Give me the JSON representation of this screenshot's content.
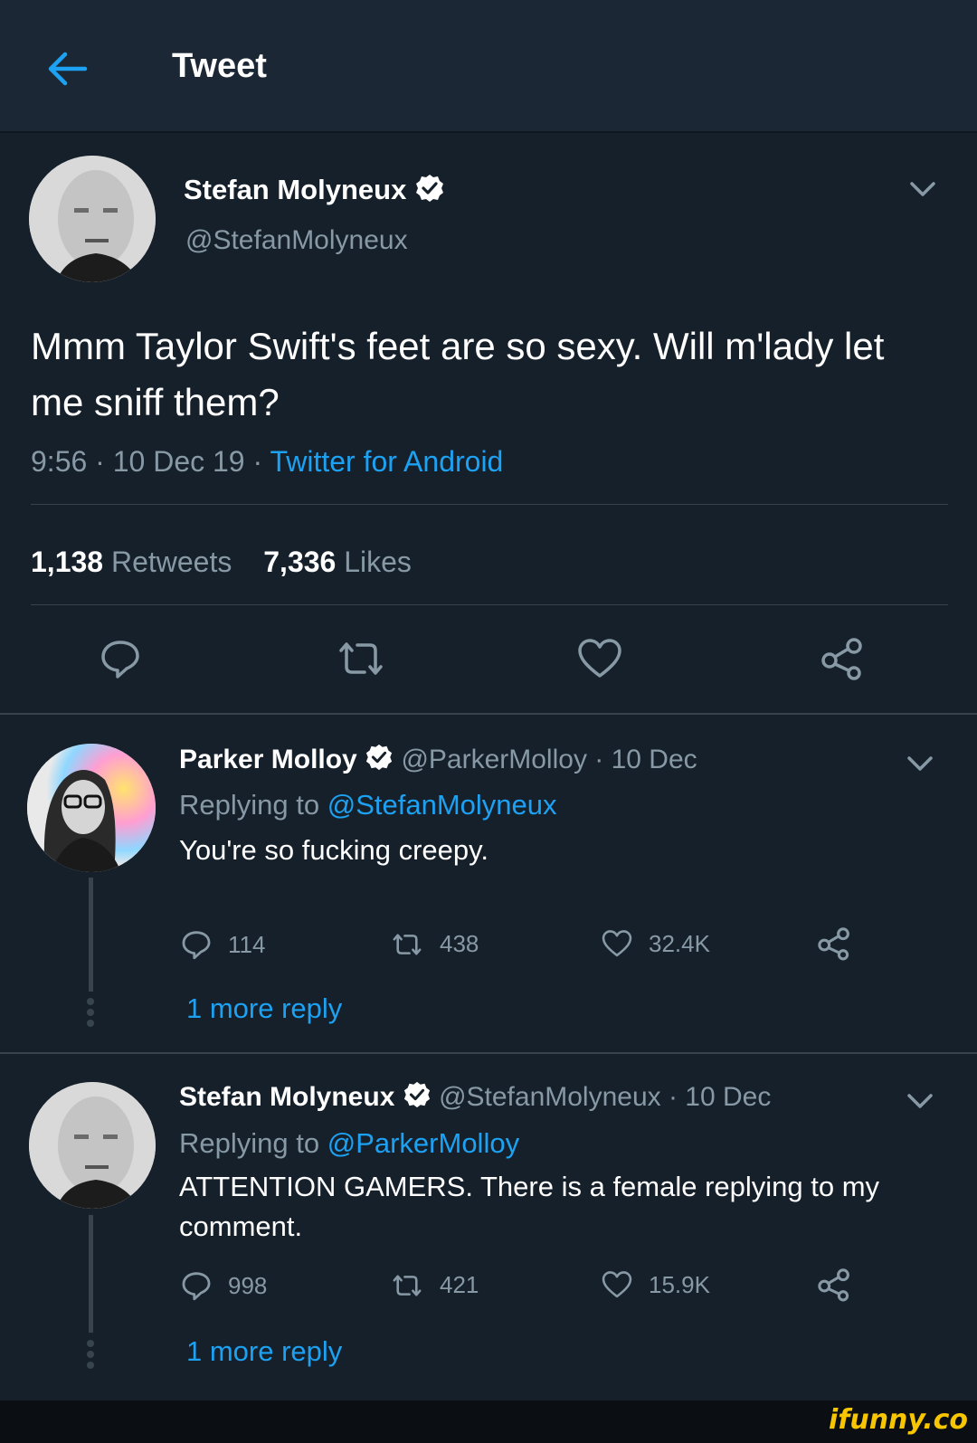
{
  "header": {
    "title": "Tweet",
    "back_icon": "arrow-left-icon",
    "accent": "#1da1f2"
  },
  "tweet": {
    "author_name": "Stefan Molyneux",
    "handle": "@StefanMolyneux",
    "text": "Mmm Taylor Swift's feet are so sexy. Will m'lady let me sniff them?",
    "time": "9:56 · 10 Dec 19 · ",
    "source": "Twitter for Android",
    "retweets_count": "1,138",
    "retweets_label": "Retweets",
    "likes_count": "7,336",
    "likes_label": "Likes"
  },
  "replies": [
    {
      "author_name": "Parker Molloy",
      "handle_date": "@ParkerMolloy · 10 Dec",
      "replying_prefix": "Replying to ",
      "replying_to": "@StefanMolyneux",
      "text": "You're so fucking creepy.",
      "replies": "114",
      "retweets": "438",
      "likes": "32.4K",
      "more": "1 more reply"
    },
    {
      "author_name": "Stefan Molyneux",
      "handle_date": "@StefanMolyneux · 10 Dec",
      "replying_prefix": "Replying to ",
      "replying_to": "@ParkerMolloy",
      "text": "ATTENTION GAMERS. There is a female replying to my comment.",
      "replies": "998",
      "retweets": "421",
      "likes": "15.9K",
      "more": "1 more reply"
    }
  ],
  "watermark": "ifunny.co",
  "colors": {
    "background": "#15202b",
    "header": "#1b2734",
    "muted": "#8899a6",
    "link": "#1da1f2",
    "divider": "#38444d",
    "watermark": "#f7c600"
  }
}
